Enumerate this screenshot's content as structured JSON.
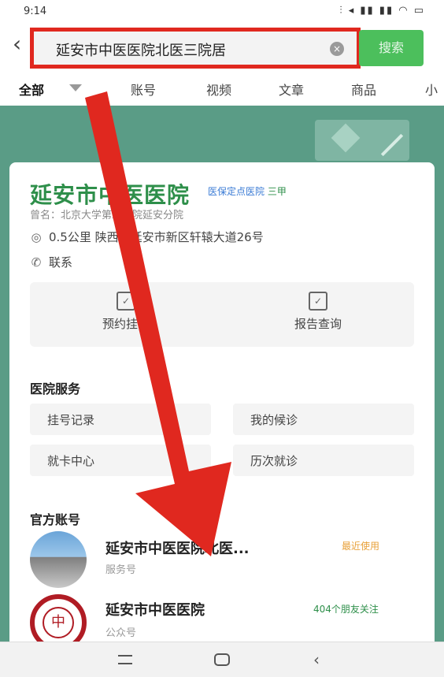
{
  "status_bar": {
    "time": "9:14",
    "icons_text": "⫶ ◂ ▮▮ ▮▮ ◠ ▭"
  },
  "search": {
    "query": "延安市中医医院北医三院居",
    "button_label": "搜索",
    "clear_icon": "close-icon"
  },
  "tabs": [
    {
      "label": "全部",
      "active": true
    },
    {
      "label": "账号"
    },
    {
      "label": "视频"
    },
    {
      "label": "文章"
    },
    {
      "label": "商品"
    },
    {
      "label": "小"
    }
  ],
  "hospital": {
    "name": "延安市中医医院",
    "badges": "医保定点医院",
    "level": "三甲",
    "alias": "曾名：北京大学第三医院延安分院",
    "distance": "0.5公里",
    "address": "陕西省延安市新区轩辕大道26号",
    "contact_label": "联系",
    "quick_actions": [
      {
        "label": "预约挂号",
        "icon": "calendar-icon"
      },
      {
        "label": "报告查询",
        "icon": "report-icon"
      }
    ]
  },
  "services": {
    "title": "医院服务",
    "items": [
      "挂号记录",
      "我的候诊",
      "就卡中心",
      "历次就诊"
    ]
  },
  "official_accounts": {
    "title": "官方账号",
    "items": [
      {
        "name": "延安市中医医院北医...",
        "type": "服务号",
        "tag": "最近使用"
      },
      {
        "name": "延安市中医医院",
        "type": "公众号",
        "tag": "404个朋友关注"
      }
    ]
  },
  "colors": {
    "accent_green": "#2e8f4a",
    "banner": "#5a9c86",
    "highlight_red": "#e0281f"
  }
}
